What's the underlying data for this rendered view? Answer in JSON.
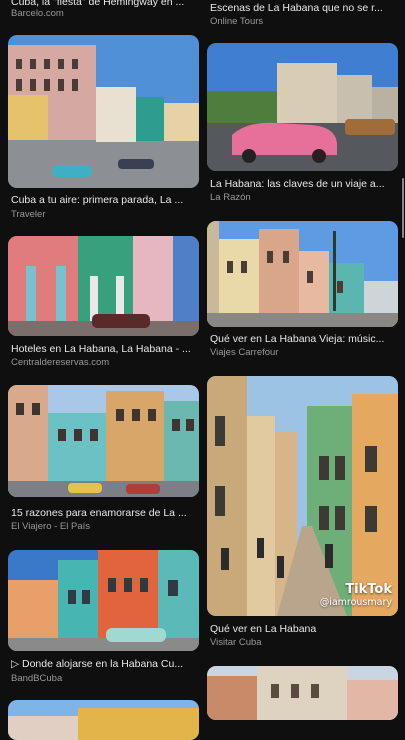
{
  "left_column": [
    {
      "title": "Cuba, la \"fiesta\" de Hemingway en ...",
      "source": "Barcelo.com"
    },
    {
      "title": "Cuba a tu aire: primera parada, La ...",
      "source": "Traveler"
    },
    {
      "title": "Hoteles en La Habana, La Habana - ...",
      "source": "Centraldereservas.com"
    },
    {
      "title": "15 razones para enamorarse de La ...",
      "source": "El Viajero - El País"
    },
    {
      "title": "▷ Donde alojarse en la Habana Cu...",
      "source": "BandBCuba"
    }
  ],
  "right_column": [
    {
      "title": "Escenas de La Habana que no se r...",
      "source": "Online Tours"
    },
    {
      "title": "La Habana: las claves de un viaje a...",
      "source": "La Razón"
    },
    {
      "title": "Qué ver en La Habana Vieja: músic...",
      "source": "Viajes Carrefour"
    },
    {
      "title": "Qué ver en La Habana",
      "source": "Visitar Cuba"
    }
  ],
  "watermark": {
    "brand": "TikTok",
    "handle": "@iamrousmary"
  }
}
